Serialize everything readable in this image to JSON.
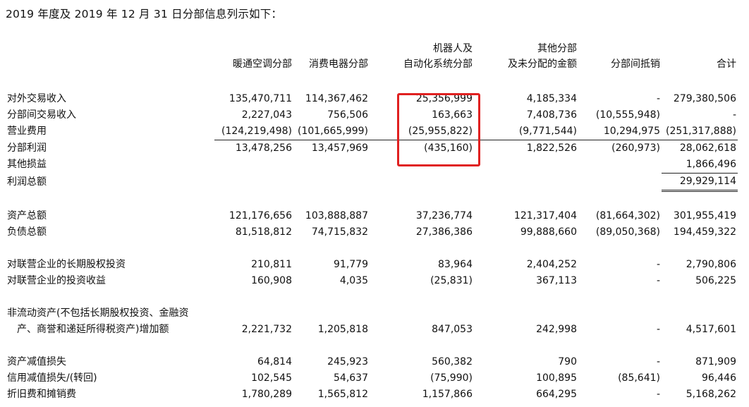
{
  "title": "2019 年度及 2019 年 12 月 31 日分部信息列示如下：",
  "columns": [
    {
      "lines": [
        "",
        "暖通空调分部"
      ]
    },
    {
      "lines": [
        "",
        "消费电器分部"
      ]
    },
    {
      "lines": [
        "机器人及",
        "自动化系统分部"
      ]
    },
    {
      "lines": [
        "其他分部",
        "及未分配的金额"
      ]
    },
    {
      "lines": [
        "",
        "分部间抵销"
      ]
    },
    {
      "lines": [
        "",
        "合计"
      ]
    }
  ],
  "rows": {
    "r1": {
      "label": "对外交易收入",
      "values": [
        "135,470,711",
        "114,367,462",
        "25,356,999",
        "4,185,334",
        "-",
        "279,380,506"
      ]
    },
    "r2": {
      "label": "分部间交易收入",
      "values": [
        "2,227,043",
        "756,506",
        "163,663",
        "7,408,736",
        "(10,555,948)",
        "-"
      ]
    },
    "r3": {
      "label": "营业费用",
      "values": [
        "(124,219,498)",
        "(101,665,999)",
        "(25,955,822)",
        "(9,771,544)",
        "10,294,975",
        "(251,317,888)"
      ]
    },
    "r4": {
      "label": "分部利润",
      "values": [
        "13,478,256",
        "13,457,969",
        "(435,160)",
        "1,822,526",
        "(260,973)",
        "28,062,618"
      ]
    },
    "r5": {
      "label": "其他损益",
      "values": [
        "",
        "",
        "",
        "",
        "",
        "1,866,496"
      ]
    },
    "r6": {
      "label": "利润总额",
      "values": [
        "",
        "",
        "",
        "",
        "",
        "29,929,114"
      ]
    },
    "r7": {
      "label": "资产总额",
      "values": [
        "121,176,656",
        "103,888,887",
        "37,236,774",
        "121,317,404",
        "(81,664,302)",
        "301,955,419"
      ]
    },
    "r8": {
      "label": "负债总额",
      "values": [
        "81,518,812",
        "74,715,832",
        "27,386,386",
        "99,888,660",
        "(89,050,368)",
        "194,459,322"
      ]
    },
    "r9": {
      "label": "对联营企业的长期股权投资",
      "values": [
        "210,811",
        "91,779",
        "83,964",
        "2,404,252",
        "-",
        "2,790,806"
      ]
    },
    "r10": {
      "label": "对联营企业的投资收益",
      "values": [
        "160,908",
        "4,035",
        "(25,831)",
        "367,113",
        "-",
        "506,225"
      ]
    },
    "r11": {
      "label_lines": [
        "非流动资产(不包括长期股权投资、金融资",
        "产、商誉和递延所得税资产)增加额"
      ],
      "values": [
        "2,221,732",
        "1,205,818",
        "847,053",
        "242,998",
        "-",
        "4,517,601"
      ]
    },
    "r12": {
      "label": "资产减值损失",
      "values": [
        "64,814",
        "245,923",
        "560,382",
        "790",
        "-",
        "871,909"
      ]
    },
    "r13": {
      "label": "信用减值损失/(转回)",
      "values": [
        "102,545",
        "54,637",
        "(75,990)",
        "100,895",
        "(85,641)",
        "96,446"
      ]
    },
    "r14": {
      "label": "折旧费和摊销费",
      "values": [
        "1,780,289",
        "1,565,812",
        "1,157,866",
        "664,295",
        "-",
        "5,168,262"
      ]
    }
  },
  "colors": {
    "highlight": "#e02020",
    "text": "#111111"
  }
}
